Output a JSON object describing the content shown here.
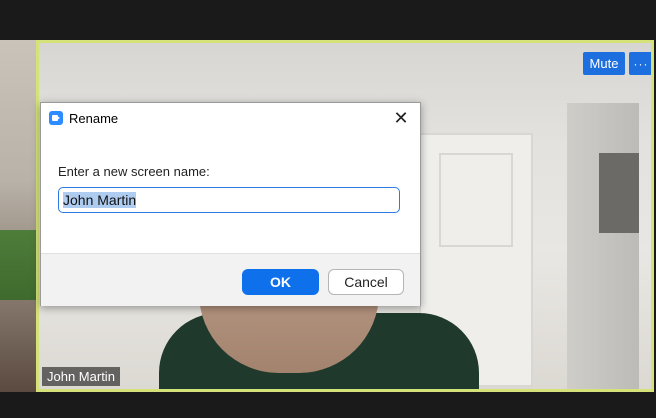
{
  "meeting": {
    "participant_name": "John Martin",
    "mute_label": "Mute",
    "more_label": "···"
  },
  "dialog": {
    "title": "Rename",
    "close_glyph": "✕",
    "prompt": "Enter a new screen name:",
    "input_value": "John Martin",
    "ok_label": "OK",
    "cancel_label": "Cancel"
  },
  "icons": {
    "app": "zoom-app-icon",
    "close": "close-icon"
  },
  "colors": {
    "active_speaker_border": "#d5e27a",
    "primary_button": "#0e71eb",
    "tile_button": "#1d6fe0",
    "selection": "#aecbf0"
  }
}
